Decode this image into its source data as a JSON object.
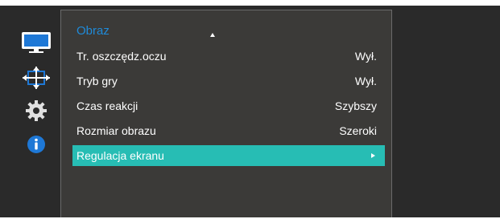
{
  "menu": {
    "title": "Obraz",
    "items": [
      {
        "label": "Tr. oszczędz.oczu",
        "value": "Wył."
      },
      {
        "label": "Tryb gry",
        "value": "Wył."
      },
      {
        "label": "Czas reakcji",
        "value": "Szybszy"
      },
      {
        "label": "Rozmiar obrazu",
        "value": "Szeroki"
      },
      {
        "label": "Regulacja ekranu",
        "value": ""
      }
    ],
    "selected_index": 4
  },
  "rail": {
    "icons": [
      "picture-icon",
      "position-arrows-icon",
      "gear-icon",
      "info-icon"
    ],
    "active_index": 0
  },
  "colors": {
    "accent": "#27bdb4",
    "title": "#1f8ad8",
    "panel": "#3b3a38",
    "background": "#2a2a2a"
  }
}
